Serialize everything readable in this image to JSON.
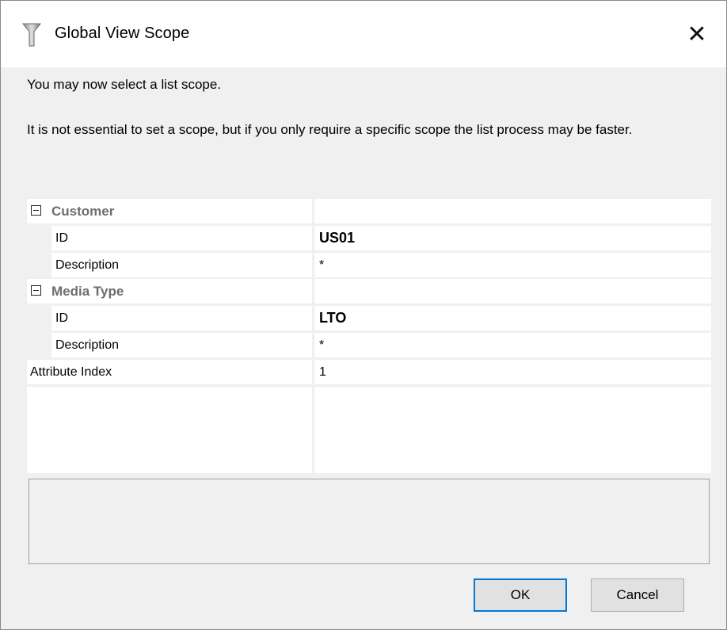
{
  "window": {
    "title": "Global View Scope",
    "close_glyph": "✕"
  },
  "messages": {
    "line1": "You may now select a list scope.",
    "line2": "It is not essential to set a scope, but if you only require a specific scope the list process may be faster."
  },
  "grid": {
    "customer": {
      "category": "Customer",
      "id_label": "ID",
      "id_value": "US01",
      "description_label": "Description",
      "description_value": "*"
    },
    "media_type": {
      "category": "Media Type",
      "id_label": "ID",
      "id_value": "LTO",
      "description_label": "Description",
      "description_value": "*"
    },
    "attribute_index": {
      "label": "Attribute Index",
      "value": "1"
    }
  },
  "buttons": {
    "ok": "OK",
    "cancel": "Cancel"
  },
  "colors": {
    "accent": "#0078d7",
    "dialog_bg": "#f0f0f0",
    "category_text": "#6d6d6d"
  }
}
